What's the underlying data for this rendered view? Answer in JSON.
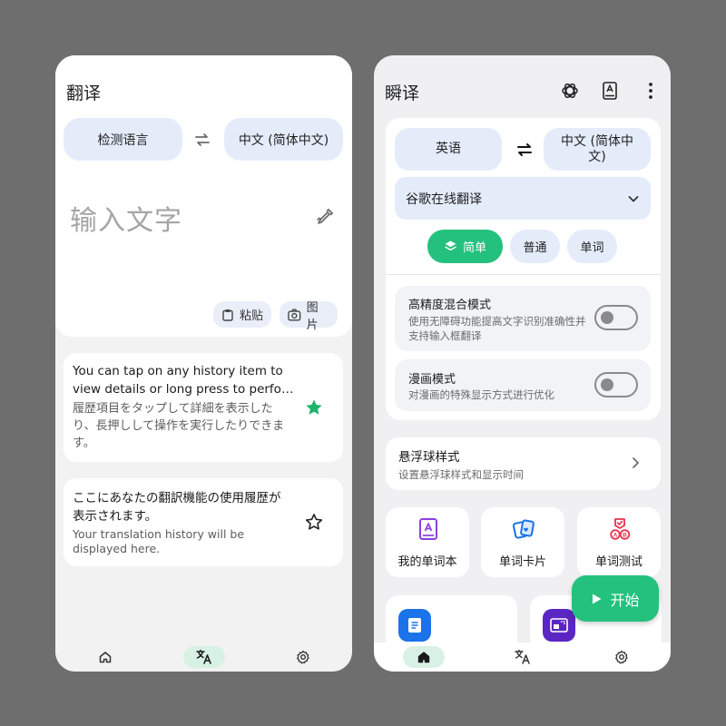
{
  "left": {
    "title": "翻译",
    "source_lang": "检测语言",
    "target_lang": "中文 (简体中文)",
    "input_placeholder": "输入文字",
    "paste_label": "粘贴",
    "photo_label": "图片",
    "history": [
      {
        "en": "You can tap on any history item to view details or long press to perfo…",
        "jp": "履歴項目をタップして詳細を表示したり、長押しして操作を実行したりできます。",
        "starred": true
      },
      {
        "jp_main": "ここにあなたの翻訳機能の使用履歴が表示されます。",
        "en_sub": "Your translation history will be displayed here.",
        "starred": false
      }
    ],
    "bottom_nav": [
      "home-icon",
      "translate-icon",
      "settings-icon"
    ],
    "active_nav": "translate"
  },
  "right": {
    "title": "瞬译",
    "source_lang": "英语",
    "target_lang": "中文 (简体中文)",
    "engine": "谷歌在线翻译",
    "modes": [
      "简单",
      "普通",
      "单词"
    ],
    "active_mode": "简单",
    "toggles": [
      {
        "title": "高精度混合模式",
        "subtitle": "使用无障碍功能提高文字识别准确性并支持输入框翻译",
        "on": false
      },
      {
        "title": "漫画模式",
        "subtitle": "对漫画的特殊显示方式进行优化",
        "on": false
      }
    ],
    "float_ball": {
      "title": "悬浮球样式",
      "subtitle": "设置悬浮球样式和显示时间"
    },
    "tiles": [
      {
        "label": "我的单词本",
        "icon": "wordbook-icon"
      },
      {
        "label": "单词卡片",
        "icon": "word-cards-icon"
      },
      {
        "label": "单词测试",
        "icon": "word-test-icon"
      }
    ],
    "fab_label": "开始",
    "bottom_nav": [
      "home-icon",
      "translate-icon",
      "settings-icon"
    ],
    "active_nav": "home"
  },
  "colors": {
    "accent_green": "#24c17e",
    "pill_blue": "#e4ecfa",
    "star_green": "#1fb36c"
  }
}
